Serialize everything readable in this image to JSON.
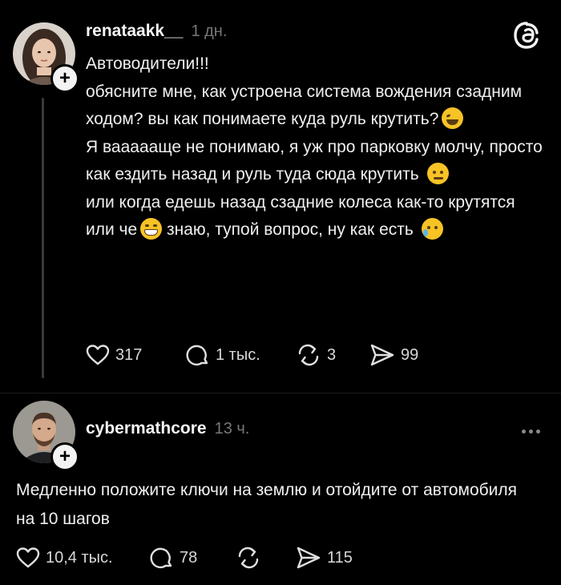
{
  "colors": {
    "background": "#000000",
    "text": "#f0f0f0",
    "muted": "#777777",
    "thread_line": "#3a3a3a"
  },
  "app_logo_icon": "threads-logo-icon",
  "posts": [
    {
      "username": "renataakk__",
      "time": "1 дн.",
      "avatar_icon": "avatar-woman",
      "follow_icon": "plus-icon",
      "body": {
        "line1": "Автоводители!!!",
        "line2": "обясните мне, как устроена система вождения сзадним ходом? вы как понимаете куда руль крутить?",
        "line3": "Я ваааааще не понимаю, я уж про парковку молчу, просто как ездить назад и руль туда сюда крутить",
        "line4a": "или когда едешь назад сзадние колеса как-то крутятся или че",
        "line4b": " знаю, тупой вопрос, ну как есть"
      },
      "emojis": [
        "rolling-laugh-emoji",
        "melting-face-emoji",
        "grinning-squint-emoji",
        "crying-face-emoji"
      ],
      "actions": {
        "likes": "317",
        "replies": "1 тыс.",
        "reposts": "3",
        "shares": "99"
      }
    },
    {
      "username": "cybermathcore",
      "time": "13 ч.",
      "avatar_icon": "avatar-man",
      "follow_icon": "plus-icon",
      "body": {
        "line1": "Медленно положите ключи на землю и отойдите от автомобиля на 10 шагов"
      },
      "actions": {
        "likes": "10,4 тыс.",
        "replies": "78",
        "reposts": "",
        "shares": "115"
      },
      "more_icon": "more-options-icon"
    }
  ]
}
